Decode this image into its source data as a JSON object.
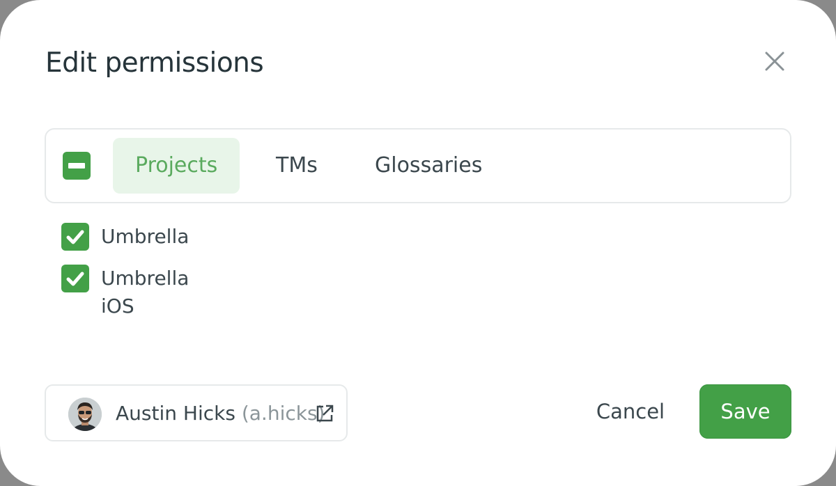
{
  "dialog": {
    "title": "Edit permissions"
  },
  "tabs": [
    {
      "label": "Projects",
      "active": true
    },
    {
      "label": "TMs",
      "active": false
    },
    {
      "label": "Glossaries",
      "active": false
    }
  ],
  "select_all": {
    "state": "indeterminate"
  },
  "items": [
    {
      "label": "Umbrella",
      "checked": true
    },
    {
      "label": "Umbrella iOS",
      "checked": true
    }
  ],
  "user": {
    "name": "Austin Hicks",
    "handle": "(a.hicks)",
    "icon": "external-link-icon"
  },
  "footer": {
    "cancel_label": "Cancel",
    "save_label": "Save"
  },
  "colors": {
    "accent": "#43a047",
    "active_tab_bg": "#e8f5e9",
    "active_tab_text": "#5aaa5e",
    "text": "#3b474d",
    "muted": "#8b9599"
  }
}
